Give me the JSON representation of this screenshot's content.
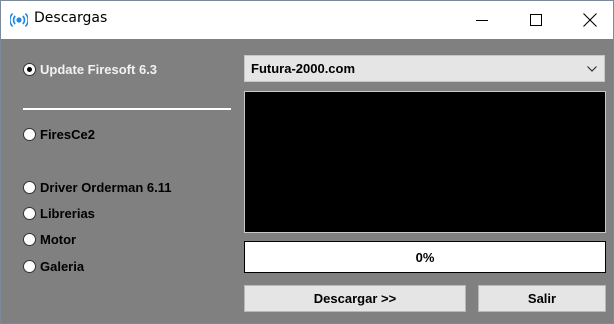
{
  "window": {
    "title": "Descargas",
    "icon": "radio-waves-icon",
    "accent_color": "#1e88e5"
  },
  "options": [
    {
      "label": "Update Firesoft 6.3",
      "checked": true
    },
    {
      "label": "FiresCe2",
      "checked": false
    },
    {
      "label": "Driver Orderman 6.11",
      "checked": false
    },
    {
      "label": "Librerias",
      "checked": false
    },
    {
      "label": "Motor",
      "checked": false
    },
    {
      "label": "Galeria",
      "checked": false
    }
  ],
  "server_select": {
    "value": "Futura-2000.com"
  },
  "progress": {
    "percent": 0,
    "text": "0%"
  },
  "buttons": {
    "download": "Descargar >>",
    "exit": "Salir"
  }
}
